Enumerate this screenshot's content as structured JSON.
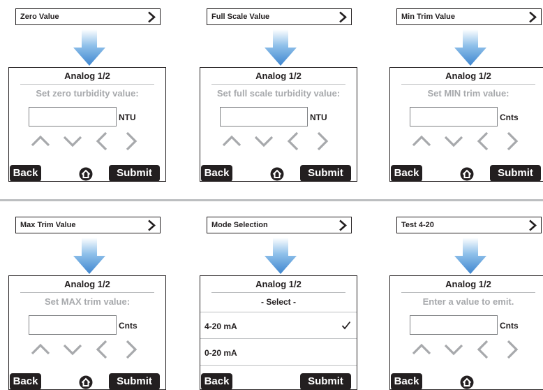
{
  "screen": {
    "title": "Analog 1/2",
    "back_label": "Back",
    "submit_label": "Submit"
  },
  "panels": [
    {
      "menu_label": "Zero Value",
      "prompt": "Set zero turbidity value:",
      "unit": "NTU"
    },
    {
      "menu_label": "Full Scale Value",
      "prompt": "Set full scale turbidity value:",
      "unit": "NTU"
    },
    {
      "menu_label": "Min Trim Value",
      "prompt": "Set MIN trim value:",
      "unit": "Cnts"
    },
    {
      "menu_label": "Max Trim Value",
      "prompt": "Set MAX trim value:",
      "unit": "Cnts"
    },
    {
      "menu_label": "Mode Selection",
      "select_header": "- Select -",
      "options": [
        {
          "label": "4-20 mA",
          "selected": true
        },
        {
          "label": "0-20 mA",
          "selected": false
        }
      ]
    },
    {
      "menu_label": "Test 4-20",
      "prompt": "Enter a value to emit.",
      "unit": "Cnts"
    }
  ],
  "colors": {
    "arrow": "#5b9bd5",
    "dark": "#231f20",
    "muted": "#a7a9ac"
  },
  "icons": [
    "chevron-right-icon",
    "down-arrow-icon",
    "up-nav-icon",
    "down-nav-icon",
    "left-nav-icon",
    "right-nav-icon",
    "home-icon",
    "checkmark-icon"
  ]
}
